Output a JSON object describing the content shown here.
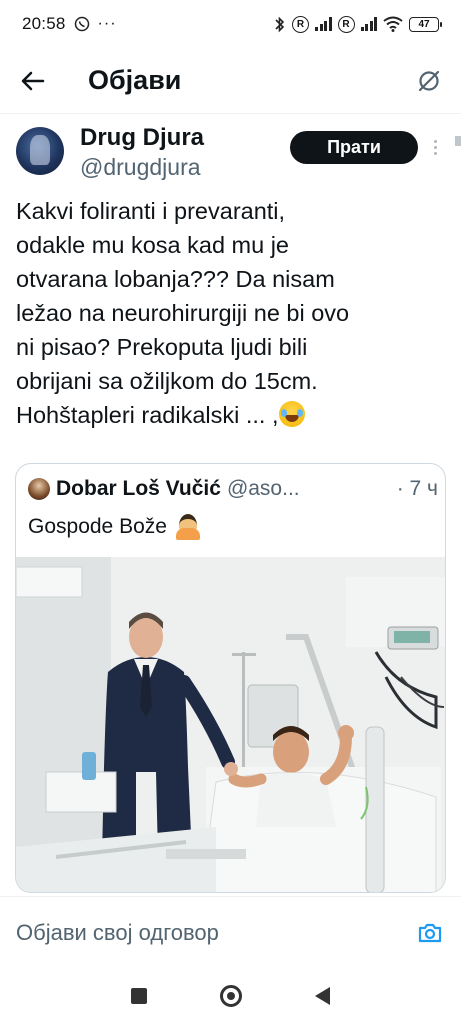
{
  "status_bar": {
    "time": "20:58",
    "battery": "47"
  },
  "header": {
    "title": "Објави"
  },
  "tweet": {
    "display_name": "Drug Djura",
    "handle": "@drugdjura",
    "follow_label": "Прати",
    "text": "Kakvi foliranti i prevaranti,\nodakle mu kosa kad mu je\notvarana lobanja??? Da nisam\nležao na neurohirurgiji ne bi ovo\nni pisao? Prekoputa ljudi bili\nobrijani sa ožiljkom do 15cm.\nHohštapleri radikalski ... ,"
  },
  "quote": {
    "display_name": "Dobar Loš Vučić",
    "handle": "@aso...",
    "time": "· 7 ч",
    "text": "Gospode Bože"
  },
  "reply": {
    "placeholder": "Објави свој одговор"
  },
  "colors": {
    "text_primary": "#0f1419",
    "text_secondary": "#536471",
    "accent": "#1d9bf0",
    "border": "#cfd9de"
  }
}
